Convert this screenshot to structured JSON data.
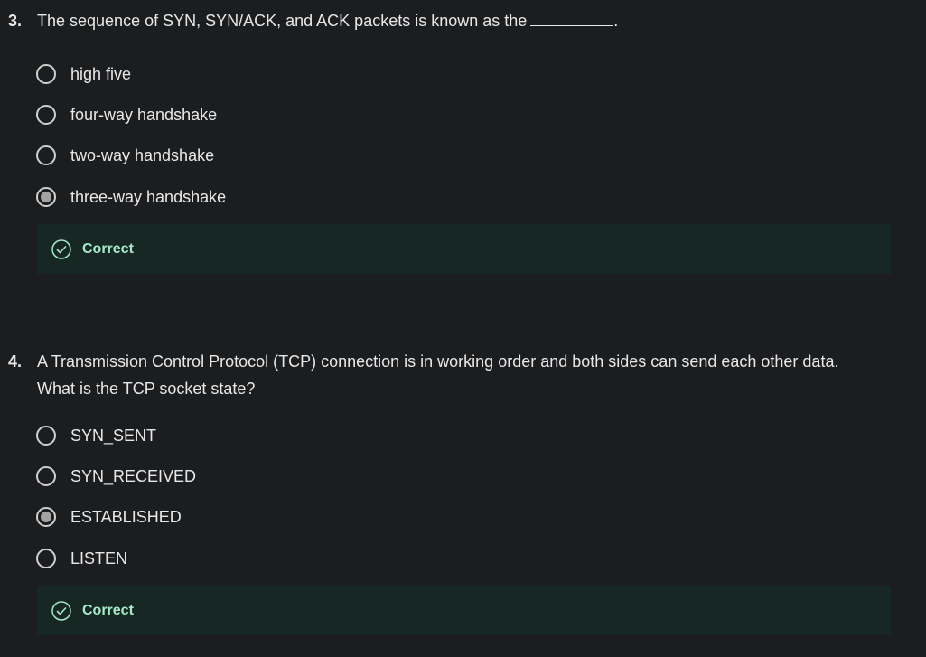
{
  "questions": [
    {
      "number": "3.",
      "text": "The sequence of SYN, SYN/ACK, and ACK packets is known as the",
      "trailing": ".",
      "options": [
        {
          "label": "high five",
          "selected": false
        },
        {
          "label": "four-way handshake",
          "selected": false
        },
        {
          "label": "two-way handshake",
          "selected": false
        },
        {
          "label": "three-way handshake",
          "selected": true
        }
      ],
      "feedback": "Correct"
    },
    {
      "number": "4.",
      "text": "A Transmission Control Protocol (TCP) connection is in working order and both sides can send each other data. What is the TCP socket state?",
      "options": [
        {
          "label": "SYN_SENT",
          "selected": false
        },
        {
          "label": "SYN_RECEIVED",
          "selected": false
        },
        {
          "label": "ESTABLISHED",
          "selected": true
        },
        {
          "label": "LISTEN",
          "selected": false
        }
      ],
      "feedback": "Correct"
    }
  ],
  "colors": {
    "background": "#1c1d1f",
    "feedback_bg": "#172824",
    "feedback_text": "#a6e9c9"
  }
}
